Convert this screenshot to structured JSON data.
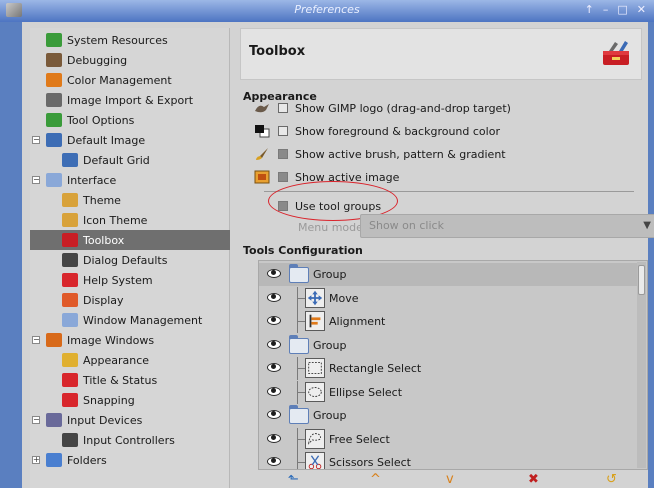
{
  "window": {
    "title": "Preferences",
    "controls": [
      "↑",
      "–",
      "□",
      "✕"
    ]
  },
  "sidebar": {
    "items": [
      {
        "label": "System Resources",
        "icon": "chip-icon",
        "color": "#3a9b3a",
        "indent": 0,
        "expander": ""
      },
      {
        "label": "Debugging",
        "icon": "bug-icon",
        "color": "#7a5a3a",
        "indent": 0,
        "expander": ""
      },
      {
        "label": "Color Management",
        "icon": "color-star-icon",
        "color": "#e07a1a",
        "indent": 0,
        "expander": ""
      },
      {
        "label": "Image Import & Export",
        "icon": "import-icon",
        "color": "#6a6a6a",
        "indent": 0,
        "expander": ""
      },
      {
        "label": "Tool Options",
        "icon": "wand-icon",
        "color": "#3a9b3a",
        "indent": 0,
        "expander": ""
      },
      {
        "label": "Default Image",
        "icon": "image-icon",
        "color": "#3d6db5",
        "indent": 0,
        "expander": "−"
      },
      {
        "label": "Default Grid",
        "icon": "grid-icon",
        "color": "#3d6db5",
        "indent": 1,
        "expander": ""
      },
      {
        "label": "Interface",
        "icon": "window-icon",
        "color": "#8aa8d8",
        "indent": 0,
        "expander": "−"
      },
      {
        "label": "Theme",
        "icon": "theme-icon",
        "color": "#d8a23a",
        "indent": 1,
        "expander": ""
      },
      {
        "label": "Icon Theme",
        "icon": "icon-theme-icon",
        "color": "#d8a23a",
        "indent": 1,
        "expander": ""
      },
      {
        "label": "Toolbox",
        "icon": "toolbox-icon",
        "color": "#c81e24",
        "indent": 1,
        "expander": "",
        "selected": true
      },
      {
        "label": "Dialog Defaults",
        "icon": "dialog-icon",
        "color": "#444444",
        "indent": 1,
        "expander": ""
      },
      {
        "label": "Help System",
        "icon": "lifebuoy-icon",
        "color": "#d8262c",
        "indent": 1,
        "expander": ""
      },
      {
        "label": "Display",
        "icon": "display-icon",
        "color": "#e05a2a",
        "indent": 1,
        "expander": ""
      },
      {
        "label": "Window Management",
        "icon": "window-mgmt-icon",
        "color": "#8aa8d8",
        "indent": 1,
        "expander": ""
      },
      {
        "label": "Image Windows",
        "icon": "image-window-icon",
        "color": "#d86a1a",
        "indent": 0,
        "expander": "−"
      },
      {
        "label": "Appearance",
        "icon": "appearance-icon",
        "color": "#e0b030",
        "indent": 1,
        "expander": ""
      },
      {
        "label": "Title & Status",
        "icon": "title-status-icon",
        "color": "#d8262c",
        "indent": 1,
        "expander": ""
      },
      {
        "label": "Snapping",
        "icon": "snapping-icon",
        "color": "#d8262c",
        "indent": 1,
        "expander": ""
      },
      {
        "label": "Input Devices",
        "icon": "input-device-icon",
        "color": "#6a6a9a",
        "indent": 0,
        "expander": "−"
      },
      {
        "label": "Input Controllers",
        "icon": "controller-icon",
        "color": "#444444",
        "indent": 1,
        "expander": ""
      },
      {
        "label": "Folders",
        "icon": "folder-icon",
        "color": "#4a7fd0",
        "indent": 0,
        "expander": "+"
      }
    ]
  },
  "header": {
    "title": "Toolbox"
  },
  "appearance": {
    "title": "Appearance",
    "options": [
      {
        "label": "Show GIMP logo (drag-and-drop target)",
        "icon": "wilber-icon",
        "checked": true
      },
      {
        "label": "Show foreground & background color",
        "icon": "fg-bg-color-icon",
        "checked": true
      },
      {
        "label": "Show active brush, pattern & gradient",
        "icon": "brush-icon",
        "checked": false
      },
      {
        "label": "Show active image",
        "icon": "active-image-icon",
        "checked": false
      },
      {
        "label": "Use tool groups",
        "icon": "",
        "checked": false
      }
    ],
    "menu_mode_label": "Menu mode:",
    "menu_mode_value": "Show on click"
  },
  "tools_config": {
    "title": "Tools Configuration",
    "rows": [
      {
        "type": "group",
        "label": "Group"
      },
      {
        "type": "tool",
        "label": "Move",
        "icon": "move-tool-icon"
      },
      {
        "type": "tool",
        "label": "Alignment",
        "icon": "align-tool-icon"
      },
      {
        "type": "group",
        "label": "Group"
      },
      {
        "type": "tool",
        "label": "Rectangle Select",
        "icon": "rect-select-icon"
      },
      {
        "type": "tool",
        "label": "Ellipse Select",
        "icon": "ellipse-select-icon"
      },
      {
        "type": "group",
        "label": "Group"
      },
      {
        "type": "tool",
        "label": "Free Select",
        "icon": "free-select-icon"
      },
      {
        "type": "tool",
        "label": "Scissors Select",
        "icon": "scissors-select-icon"
      }
    ]
  },
  "bottom_buttons": [
    {
      "name": "new-group-button",
      "glyph": "⬑",
      "color": "#2a6ab8"
    },
    {
      "name": "raise-button",
      "glyph": "^",
      "color": "#d8801a"
    },
    {
      "name": "lower-button",
      "glyph": "v",
      "color": "#d8801a"
    },
    {
      "name": "delete-button",
      "glyph": "✖",
      "color": "#c02020"
    },
    {
      "name": "reset-button",
      "glyph": "↺",
      "color": "#d8a01a"
    }
  ]
}
